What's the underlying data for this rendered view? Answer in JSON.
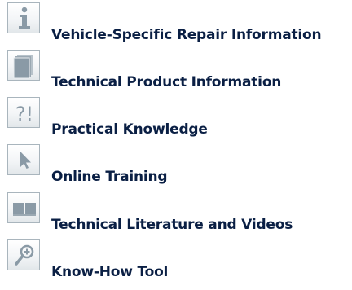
{
  "menu": {
    "items": [
      {
        "label": "Vehicle-Specific Repair Information",
        "icon": "info-icon"
      },
      {
        "label": "Technical Product Information",
        "icon": "document-icon"
      },
      {
        "label": "Practical Knowledge",
        "icon": "question-exclamation-icon"
      },
      {
        "label": "Online Training",
        "icon": "cursor-icon"
      },
      {
        "label": "Technical Literature and Videos",
        "icon": "open-book-icon"
      },
      {
        "label": "Know-How Tool",
        "icon": "magnifier-icon"
      }
    ],
    "icon_glyph_text": "?!"
  },
  "colors": {
    "label_text": "#0a1f44",
    "icon_border": "#a9b5bd",
    "icon_symbol": "#8a9aa6"
  }
}
